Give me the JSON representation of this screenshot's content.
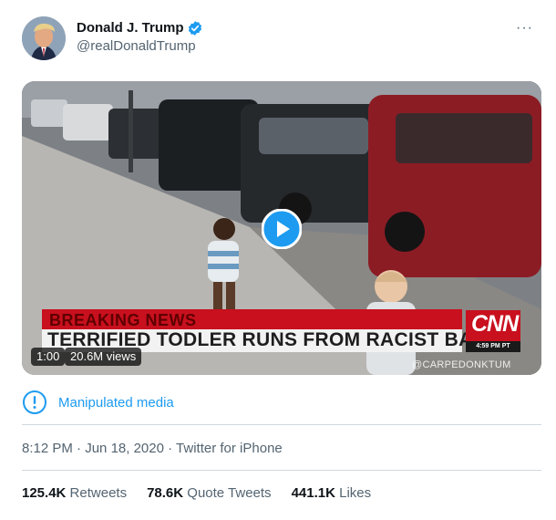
{
  "author": {
    "name": "Donald J. Trump",
    "handle": "@realDonaldTrump",
    "verified_icon": "verified-badge-icon",
    "more_icon": "more-icon",
    "more_label": "···"
  },
  "video": {
    "duration": "1:00",
    "views": "20.6M views",
    "banner_top": "BREAKING NEWS",
    "banner_bottom": "TERRIFIED TODLER RUNS FROM RACIST BABY",
    "network_logo": "CNN",
    "time_label": "4:59 PM PT",
    "watermark": "@CARPEDONKTUM",
    "play_icon": "play-icon"
  },
  "warning": {
    "icon": "exclamation-circle-icon",
    "label": "Manipulated media"
  },
  "meta": {
    "time": "8:12 PM",
    "date": "Jun 18, 2020",
    "source": "Twitter for iPhone",
    "dot": "·"
  },
  "stats": {
    "retweets_count": "125.4K",
    "retweets_label": "Retweets",
    "quotes_count": "78.6K",
    "quotes_label": "Quote Tweets",
    "likes_count": "441.1K",
    "likes_label": "Likes"
  },
  "colors": {
    "accent": "#1d9bf0",
    "text": "#0f1419",
    "secondary": "#536471",
    "cnn_red": "#c8101e"
  }
}
